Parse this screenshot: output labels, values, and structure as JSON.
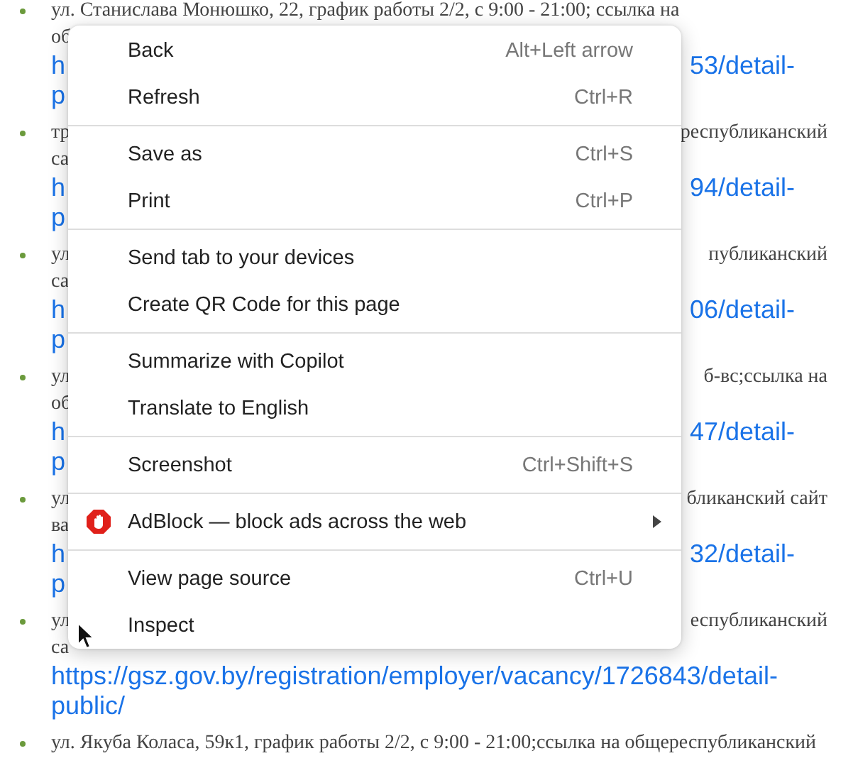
{
  "page": {
    "items": [
      {
        "lines": [
          {
            "kind": "text",
            "left": "ул. Станислава Монюшко, 22, график работы 2/2, с 9:00 - 21:00; ссылка на"
          },
          {
            "kind": "text",
            "left": "об"
          },
          {
            "kind": "link",
            "left": "h",
            "right": "53/detail-"
          },
          {
            "kind": "link",
            "left": "p"
          }
        ]
      },
      {
        "lines": [
          {
            "kind": "text",
            "left": "тр",
            "right": "республиканский"
          },
          {
            "kind": "text",
            "left": "са"
          },
          {
            "kind": "link",
            "left": "h",
            "right": "94/detail-"
          },
          {
            "kind": "link",
            "left": "p"
          }
        ]
      },
      {
        "lines": [
          {
            "kind": "text",
            "left": "ул",
            "right": "публиканский"
          },
          {
            "kind": "text",
            "left": "са"
          },
          {
            "kind": "link",
            "left": "h",
            "right": "06/detail-"
          },
          {
            "kind": "link",
            "left": "p"
          }
        ]
      },
      {
        "lines": [
          {
            "kind": "text",
            "left": "ул",
            "right": "б-вс;ссылка на"
          },
          {
            "kind": "text",
            "left": "об"
          },
          {
            "kind": "link",
            "left": "h",
            "right": "47/detail-"
          },
          {
            "kind": "link",
            "left": "p"
          }
        ]
      },
      {
        "lines": [
          {
            "kind": "text",
            "left": "ул",
            "right": "бликанский сайт"
          },
          {
            "kind": "text",
            "left": "ва"
          },
          {
            "kind": "link",
            "left": "h",
            "right": "32/detail-"
          },
          {
            "kind": "link",
            "left": "p"
          }
        ]
      },
      {
        "lines": [
          {
            "kind": "text",
            "left": "ул",
            "right": "еспубликанский"
          },
          {
            "kind": "text",
            "left": "са"
          },
          {
            "kind": "link",
            "left": "https://gsz.gov.by/registration/employer/vacancy/1726843/detail-"
          },
          {
            "kind": "link",
            "left": "public/"
          }
        ]
      },
      {
        "lines": [
          {
            "kind": "text",
            "left": "ул. Якуба Коласа, 59к1, график работы 2/2, с 9:00 - 21:00;ссылка на общереспубликанский"
          }
        ]
      }
    ]
  },
  "context_menu": {
    "items": [
      {
        "kind": "item",
        "label": "Back",
        "shortcut": "Alt+Left arrow"
      },
      {
        "kind": "item",
        "label": "Refresh",
        "shortcut": "Ctrl+R"
      },
      {
        "kind": "separator"
      },
      {
        "kind": "item",
        "label": "Save as",
        "shortcut": "Ctrl+S"
      },
      {
        "kind": "item",
        "label": "Print",
        "shortcut": "Ctrl+P"
      },
      {
        "kind": "separator"
      },
      {
        "kind": "item",
        "label": "Send tab to your devices"
      },
      {
        "kind": "item",
        "label": "Create QR Code for this page"
      },
      {
        "kind": "separator"
      },
      {
        "kind": "item",
        "label": "Summarize with Copilot"
      },
      {
        "kind": "item",
        "label": "Translate to English"
      },
      {
        "kind": "separator"
      },
      {
        "kind": "item",
        "label": "Screenshot",
        "shortcut": "Ctrl+Shift+S"
      },
      {
        "kind": "separator"
      },
      {
        "kind": "extension",
        "label": "AdBlock — block ads across the web"
      },
      {
        "kind": "separator"
      },
      {
        "kind": "item",
        "label": "View page source",
        "shortcut": "Ctrl+U"
      },
      {
        "kind": "item",
        "label": "Inspect"
      }
    ]
  }
}
